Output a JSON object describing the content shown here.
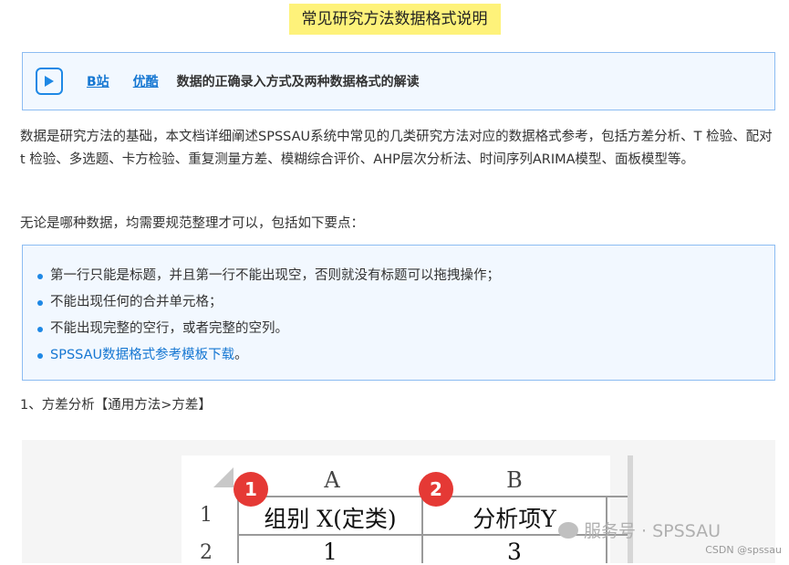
{
  "title": "常见研究方法数据格式说明",
  "video": {
    "icon": "play-icon",
    "link1": "B站",
    "link2": "优酷",
    "title": "数据的正确录入方式及两种数据格式的解读"
  },
  "intro": "数据是研究方法的基础，本文档详细阐述SPSSAU系统中常见的几类研究方法对应的数据格式参考，包括方差分析、T 检验、配对t 检验、多选题、卡方检验、重复测量方差、模糊综合评价、AHP层次分析法、时间序列ARIMA模型、面板模型等。",
  "requirement": "无论是哪种数据，均需要规范整理才可以，包括如下要点：",
  "notice": {
    "items": [
      "第一行只能是标题，并且第一行不能出现空，否则就没有标题可以拖拽操作；",
      "不能出现任何的合并单元格；",
      "不能出现完整的空行，或者完整的空列。"
    ],
    "link_text": "SPSSAU数据格式参考模板下载",
    "link_suffix": "。"
  },
  "section_heading": "1、方差分析【通用方法>方差】",
  "sheet": {
    "col_a": "A",
    "col_b": "B",
    "row1": "1",
    "row2": "2",
    "header_a": "组别 X(定类)",
    "header_b": "分析项Y",
    "value_a": "1",
    "value_b": "3",
    "badge1": "1",
    "badge2": "2"
  },
  "watermark": "服务号 · SPSSAU",
  "csdn": "CSDN @spssau",
  "colors": {
    "highlight": "#fef27a",
    "link": "#1677d2",
    "box_border": "#8cbcf2",
    "box_bg": "#f2f8ff",
    "badge": "#e53935"
  }
}
